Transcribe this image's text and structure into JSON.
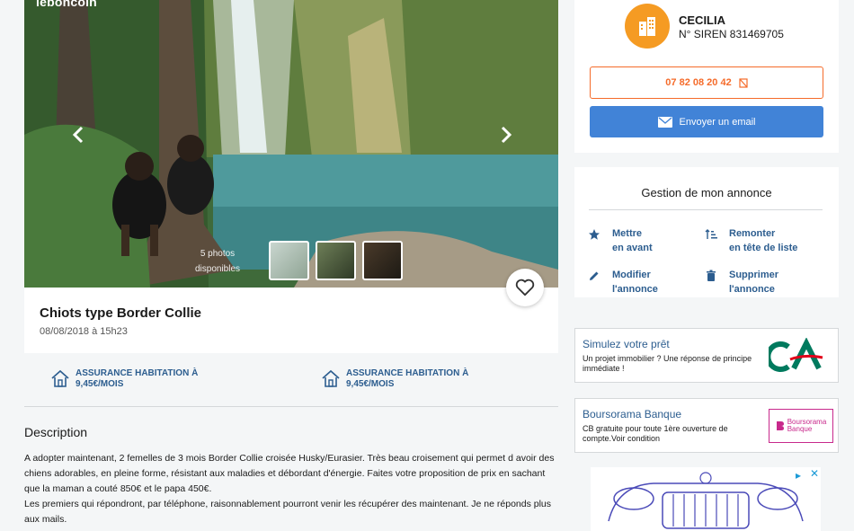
{
  "photo": {
    "logo": "leboncoin",
    "photo_count": "5 photos disponibles",
    "prev_icon": "chevron-left-icon",
    "next_icon": "chevron-right-icon"
  },
  "listing": {
    "title": "Chiots type Border Collie",
    "date": "08/08/2018 à 15h23"
  },
  "insurance": [
    {
      "label": "ASSURANCE HABITATION À 9,45€/MOIS",
      "icon": "house-icon"
    },
    {
      "label": "ASSURANCE HABITATION À 9,45€/MOIS",
      "icon": "house-icon"
    }
  ],
  "description": {
    "title": "Description",
    "paragraphs": [
      "A adopter maintenant, 2 femelles de 3 mois Border Collie croisée Husky/Eurasier. Très beau croisement qui permet d avoir des chiens adorables, en pleine forme, résistant aux maladies et débordant d'énergie. Faites votre proposition de prix en sachant que la maman a couté 850€ et le papa 450€.",
      "Les premiers qui répondront, par téléphone, raisonnablement pourront venir les récupérer des maintenant. Je ne réponds plus aux mails."
    ]
  },
  "seller": {
    "name": "CECILIA",
    "siren": "N° SIREN 831469705",
    "phone": "07 82 08 20 42",
    "email_label": "Envoyer un email"
  },
  "manage": {
    "title": "Gestion de mon annonce",
    "actions": [
      {
        "line1": "Mettre",
        "line2": "en avant",
        "icon": "star-icon"
      },
      {
        "line1": "Remonter",
        "line2": "en tête de liste",
        "icon": "sort-icon"
      },
      {
        "line1": "Modifier",
        "line2": "l'annonce",
        "icon": "pencil-icon"
      },
      {
        "line1": "Supprimer",
        "line2": "l'annonce",
        "icon": "trash-icon"
      }
    ]
  },
  "ads": [
    {
      "title": "Simulez votre prêt",
      "subtitle": "Un projet immobilier ? Une réponse de principe immédiate !",
      "logo": "CA"
    },
    {
      "title": "Boursorama Banque",
      "subtitle": "CB gratuite pour toute 1ère ouverture de compte.Voir condition",
      "logo_line1": "Boursorama",
      "logo_line2": "Banque"
    }
  ],
  "colors": {
    "accent_orange": "#f56b2a",
    "blue_button": "#4183d7",
    "link_blue": "#2c5d8f",
    "avatar_orange": "#f59b23"
  }
}
